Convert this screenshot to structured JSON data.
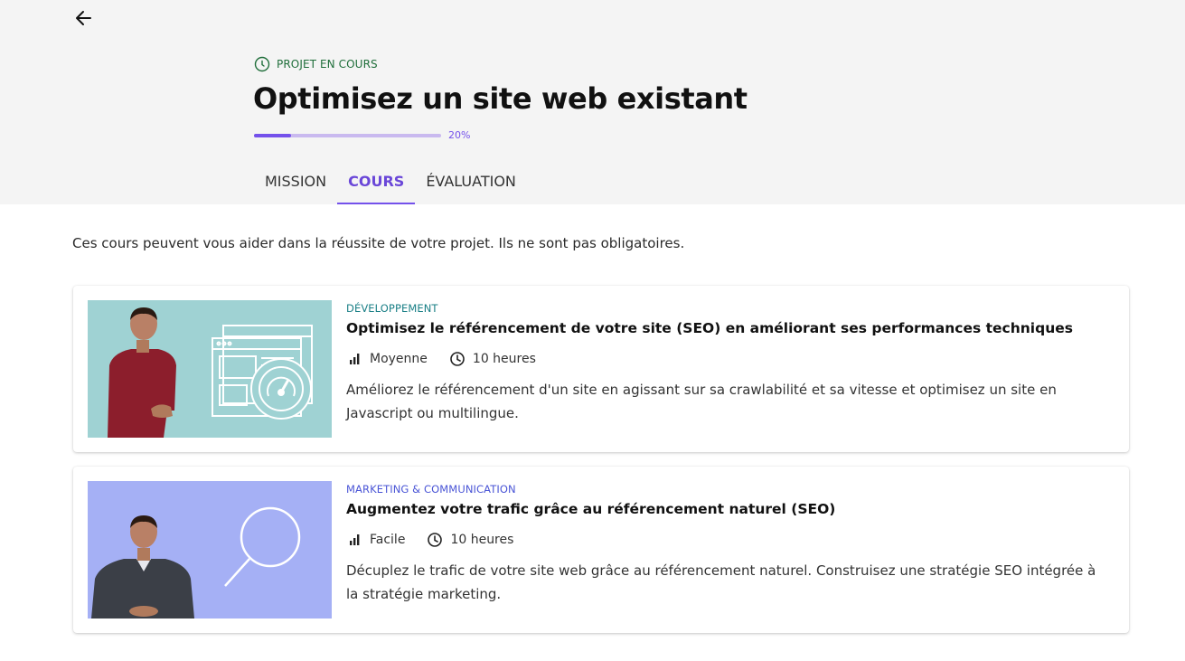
{
  "header": {
    "status_label": "PROJET EN COURS",
    "title": "Optimisez un site web existant",
    "progress_percent": 20,
    "progress_label": "20%"
  },
  "tabs": [
    {
      "label": "MISSION",
      "active": false
    },
    {
      "label": "COURS",
      "active": true
    },
    {
      "label": "ÉVALUATION",
      "active": false
    }
  ],
  "intro_text": "Ces cours peuvent vous aider dans la réussite de votre projet. Ils ne sont pas obligatoires.",
  "courses": [
    {
      "category": "DÉVELOPPEMENT",
      "category_color": "#1a7f86",
      "title": "Optimisez le référencement de votre site (SEO) en améliorant ses performances techniques",
      "difficulty": "Moyenne",
      "duration": "10 heures",
      "description": "Améliorez le référencement d'un site en agissant sur sa crawlabilité et sa vitesse et optimisez un site en Javascript ou multilingue.",
      "thumbnail_bg": "#9fd2d3",
      "thumbnail_icon": "website-speed-gauge-icon"
    },
    {
      "category": "MARKETING & COMMUNICATION",
      "category_color": "#4a55d6",
      "title": "Augmentez votre trafic grâce au référencement naturel (SEO)",
      "difficulty": "Facile",
      "duration": "10 heures",
      "description": "Décuplez le trafic de votre site web grâce au référencement naturel. Construisez une stratégie SEO intégrée à la stratégie marketing.",
      "thumbnail_bg": "#a5b0f5",
      "thumbnail_icon": "magnifying-glass-icon"
    }
  ],
  "colors": {
    "accent": "#7451eb",
    "status_green": "#1f6e3a",
    "header_bg": "#f4f4f4"
  }
}
